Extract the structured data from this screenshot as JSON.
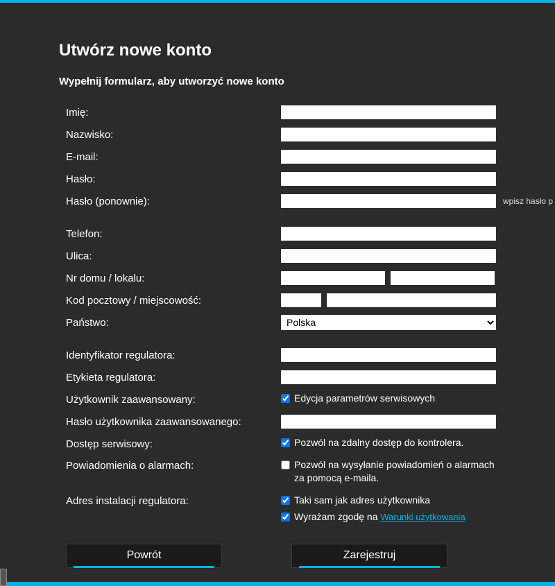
{
  "header": {
    "title": "Utwórz nowe konto",
    "subtitle": "Wypełnij formularz, aby utworzyć nowe konto"
  },
  "labels": {
    "firstname": "Imię:",
    "lastname": "Nazwisko:",
    "email": "E-mail:",
    "password": "Hasło:",
    "password_repeat": "Hasło (ponownie):",
    "phone": "Telefon:",
    "street": "Ulica:",
    "house": "Nr domu / lokalu:",
    "zip_city": "Kod pocztowy / miejscowość:",
    "country": "Państwo:",
    "regulator_id": "Identyfikator regulatora:",
    "regulator_label": "Etykieta regulatora:",
    "advanced_user": "Użytkownik zaawansowany:",
    "advanced_password": "Hasło użytkownika zaawansowanego:",
    "service_access": "Dostęp serwisowy:",
    "alarm_notifications": "Powiadomienia o alarmach:",
    "regulator_address": "Adres instalacji regulatora:"
  },
  "values": {
    "firstname": "",
    "lastname": "",
    "email": "",
    "password": "",
    "password_repeat": "",
    "phone": "",
    "street": "",
    "house1": "",
    "house2": "",
    "zip": "",
    "city": "",
    "country": "Polska",
    "regulator_id": "",
    "regulator_label": "",
    "advanced_password": ""
  },
  "checkboxes": {
    "edit_service_params": {
      "checked": true,
      "label": "Edycja parametrów serwisowych"
    },
    "remote_access": {
      "checked": true,
      "label": "Pozwól na zdalny dostęp do kontrolera."
    },
    "email_alarms": {
      "checked": false,
      "label": "Pozwól na wysyłanie powiadomień o alarmach za pomocą e-maila."
    },
    "same_address": {
      "checked": true,
      "label": "Taki sam jak adres użytkownika"
    },
    "terms": {
      "checked": true,
      "label": "Wyrażam zgodę na ",
      "link": "Warunki użytkowania"
    }
  },
  "hints": {
    "password_repeat": "wpisz hasło p"
  },
  "buttons": {
    "back": "Powrót",
    "register": "Zarejestruj"
  }
}
